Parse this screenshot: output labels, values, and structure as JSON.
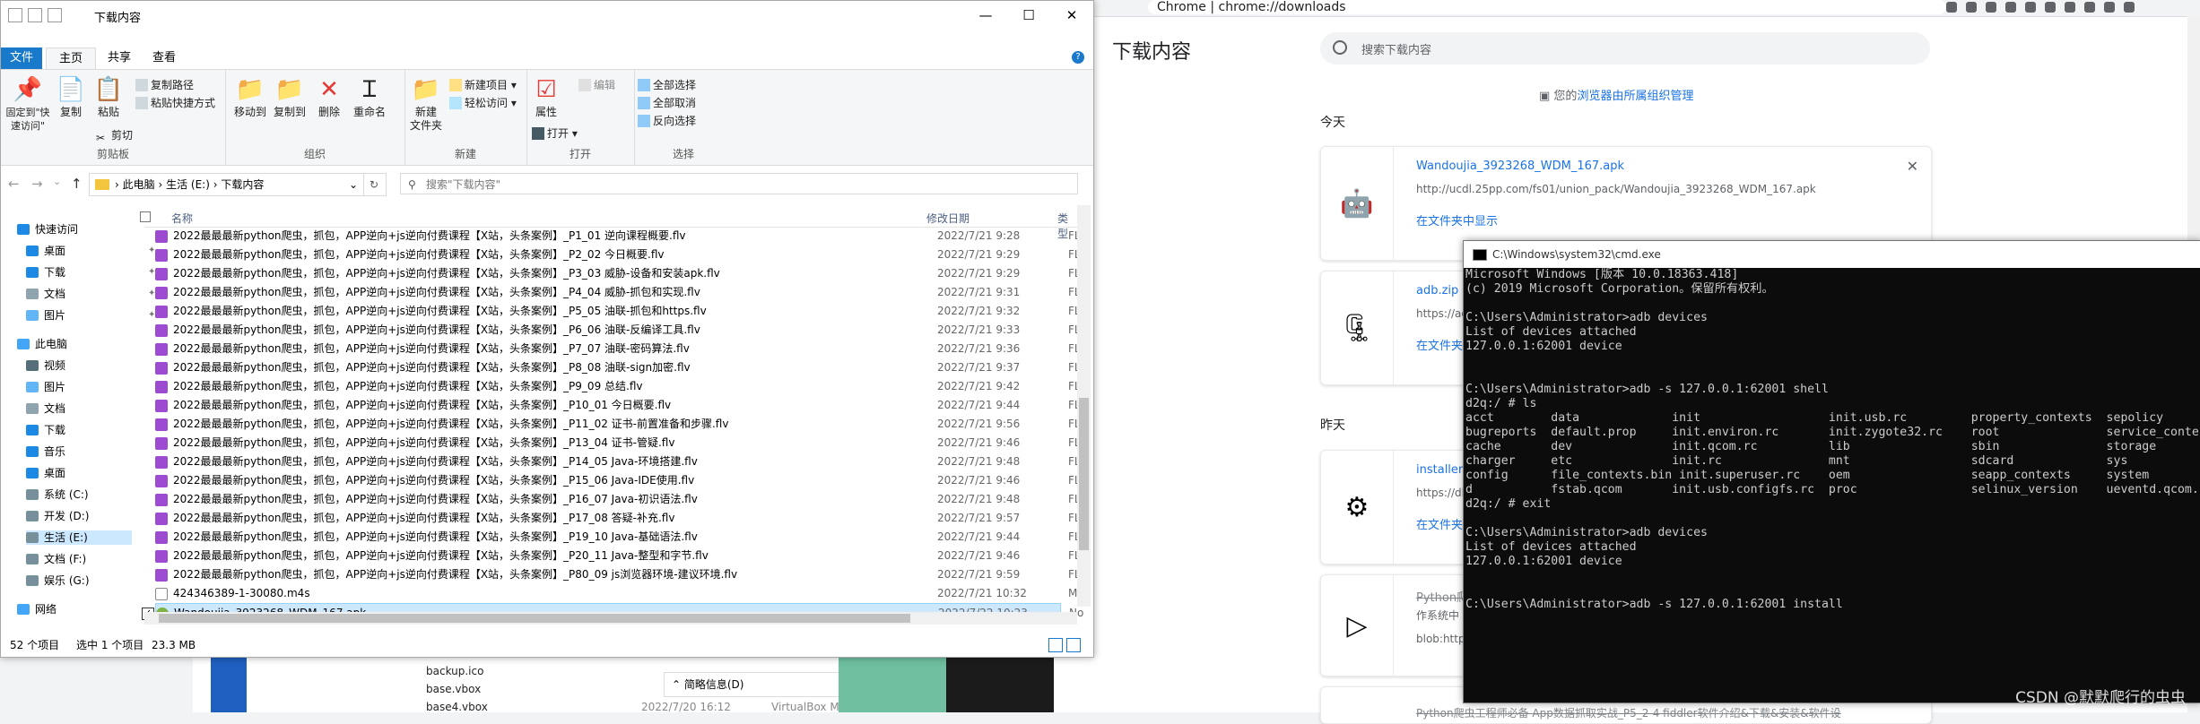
{
  "chrome": {
    "tab_label": "Chrome",
    "url": "chrome://downloads",
    "page_title": "下载内容",
    "search_placeholder": "搜索下载内容",
    "managed_prefix": "您的",
    "managed_link": "浏览器由所属组织管理",
    "today_label": "今天",
    "yesterday_label": "昨天",
    "downloads": [
      {
        "name": "Wandoujia_3923268_WDM_167.apk",
        "url": "http://ucdl.25pp.com/fs01/union_pack/Wandoujia_3923268_WDM_167.apk",
        "action": "在文件夹中显示"
      },
      {
        "name": "adb.zip",
        "url": "https://ad",
        "action": "在文件夹"
      },
      {
        "name": "installer",
        "url": "https://dl",
        "action": "在文件夹"
      },
      {
        "name": "Python爬",
        "url": "作系统中",
        "action": "blob:http"
      }
    ],
    "bottom_partial": "Python爬虫工程师必备 App数据抓取实战_P5_2-4 fiddler软件介绍&下载&安装&软件设"
  },
  "behind_explorer": {
    "rows": [
      "backup.ico",
      "base.vbox",
      "base4.vbox"
    ],
    "details_label": "简略信息(D)",
    "partial_date": "2022/7/20 16:12",
    "partial_type": "VirtualBox M"
  },
  "explorer": {
    "title": "下载内容",
    "window_controls": [
      "—",
      "☐",
      "✕"
    ],
    "tabs": {
      "file": "文件",
      "home": "主页",
      "share": "共享",
      "view": "查看"
    },
    "ribbon": {
      "pin": "固定到\"快速访问\"",
      "copy": "复制",
      "paste": "粘贴",
      "copy_path": "复制路径",
      "paste_shortcut": "粘贴快捷方式",
      "cut": "剪切",
      "clipboard_group": "剪贴板",
      "move_to": "移动到",
      "copy_to": "复制到",
      "delete": "删除",
      "rename": "重命名",
      "organize_group": "组织",
      "new_folder": "新建\n文件夹",
      "new_item": "新建项目",
      "easy_access": "轻松访问",
      "new_group": "新建",
      "properties": "属性",
      "open": "打开",
      "edit": "编辑",
      "open_group": "打开",
      "select_all": "全部选择",
      "select_none": "全部取消",
      "invert": "反向选择",
      "select_group": "选择"
    },
    "breadcrumb": [
      "此电脑",
      "生活 (E:)",
      "下载内容"
    ],
    "search_placeholder": "搜索\"下载内容\"",
    "nav": [
      {
        "label": "快速访问",
        "color": "#1e88e5"
      },
      {
        "label": "桌面",
        "color": "#1e88e5",
        "pinned": true
      },
      {
        "label": "下载",
        "color": "#1e88e5",
        "pinned": true
      },
      {
        "label": "文档",
        "color": "#90a4ae",
        "pinned": true
      },
      {
        "label": "图片",
        "color": "#64b5f6",
        "pinned": true
      },
      {
        "label": "此电脑",
        "color": "#42a5f5"
      },
      {
        "label": "视频",
        "color": "#546e7a"
      },
      {
        "label": "图片",
        "color": "#64b5f6"
      },
      {
        "label": "文档",
        "color": "#90a4ae"
      },
      {
        "label": "下载",
        "color": "#1e88e5"
      },
      {
        "label": "音乐",
        "color": "#1e88e5"
      },
      {
        "label": "桌面",
        "color": "#1e88e5"
      },
      {
        "label": "系统 (C:)",
        "color": "#78909c"
      },
      {
        "label": "开发 (D:)",
        "color": "#78909c"
      },
      {
        "label": "生活 (E:)",
        "color": "#78909c"
      },
      {
        "label": "文档 (F:)",
        "color": "#78909c"
      },
      {
        "label": "娱乐 (G:)",
        "color": "#78909c"
      },
      {
        "label": "网络",
        "color": "#42a5f5"
      }
    ],
    "columns": {
      "name": "名称",
      "date": "修改日期",
      "type": "类型"
    },
    "files": [
      {
        "name": "2022最最最新python爬虫，抓包，APP逆向+js逆向付费课程【X站，头条案例】_P1_01 逆向课程概要.flv",
        "date": "2022/7/21 9:28",
        "type": "FLV"
      },
      {
        "name": "2022最最最新python爬虫，抓包，APP逆向+js逆向付费课程【X站，头条案例】_P2_02 今日概要.flv",
        "date": "2022/7/21 9:29",
        "type": "FLV"
      },
      {
        "name": "2022最最最新python爬虫，抓包，APP逆向+js逆向付费课程【X站，头条案例】_P3_03 威胁-设备和安装apk.flv",
        "date": "2022/7/21 9:29",
        "type": "FLV"
      },
      {
        "name": "2022最最最新python爬虫，抓包，APP逆向+js逆向付费课程【X站，头条案例】_P4_04 威胁-抓包和实现.flv",
        "date": "2022/7/21 9:31",
        "type": "FLV"
      },
      {
        "name": "2022最最最新python爬虫，抓包，APP逆向+js逆向付费课程【X站，头条案例】_P5_05 油联-抓包和https.flv",
        "date": "2022/7/21 9:32",
        "type": "FLV"
      },
      {
        "name": "2022最最最新python爬虫，抓包，APP逆向+js逆向付费课程【X站，头条案例】_P6_06 油联-反编译工具.flv",
        "date": "2022/7/21 9:33",
        "type": "FLV"
      },
      {
        "name": "2022最最最新python爬虫，抓包，APP逆向+js逆向付费课程【X站，头条案例】_P7_07 油联-密码算法.flv",
        "date": "2022/7/21 9:36",
        "type": "FLV"
      },
      {
        "name": "2022最最最新python爬虫，抓包，APP逆向+js逆向付费课程【X站，头条案例】_P8_08 油联-sign加密.flv",
        "date": "2022/7/21 9:37",
        "type": "FLV"
      },
      {
        "name": "2022最最最新python爬虫，抓包，APP逆向+js逆向付费课程【X站，头条案例】_P9_09 总结.flv",
        "date": "2022/7/21 9:42",
        "type": "FLV"
      },
      {
        "name": "2022最最最新python爬虫，抓包，APP逆向+js逆向付费课程【X站，头条案例】_P10_01 今日概要.flv",
        "date": "2022/7/21 9:44",
        "type": "FLV"
      },
      {
        "name": "2022最最最新python爬虫，抓包，APP逆向+js逆向付费课程【X站，头条案例】_P11_02 证书-前置准备和步骤.flv",
        "date": "2022/7/21 9:56",
        "type": "FLV"
      },
      {
        "name": "2022最最最新python爬虫，抓包，APP逆向+js逆向付费课程【X站，头条案例】_P13_04 证书-管疑.flv",
        "date": "2022/7/21 9:46",
        "type": "FLV"
      },
      {
        "name": "2022最最最新python爬虫，抓包，APP逆向+js逆向付费课程【X站，头条案例】_P14_05 Java-环境搭建.flv",
        "date": "2022/7/21 9:48",
        "type": "FLV"
      },
      {
        "name": "2022最最最新python爬虫，抓包，APP逆向+js逆向付费课程【X站，头条案例】_P15_06 Java-IDE使用.flv",
        "date": "2022/7/21 9:46",
        "type": "FLV"
      },
      {
        "name": "2022最最最新python爬虫，抓包，APP逆向+js逆向付费课程【X站，头条案例】_P16_07 Java-初识语法.flv",
        "date": "2022/7/21 9:48",
        "type": "FLV"
      },
      {
        "name": "2022最最最新python爬虫，抓包，APP逆向+js逆向付费课程【X站，头条案例】_P17_08 答疑-补充.flv",
        "date": "2022/7/21 9:57",
        "type": "FLV"
      },
      {
        "name": "2022最最最新python爬虫，抓包，APP逆向+js逆向付费课程【X站，头条案例】_P19_10 Java-基础语法.flv",
        "date": "2022/7/21 9:44",
        "type": "FLV"
      },
      {
        "name": "2022最最最新python爬虫，抓包，APP逆向+js逆向付费课程【X站，头条案例】_P20_11 Java-整型和字节.flv",
        "date": "2022/7/21 9:46",
        "type": "FLV"
      },
      {
        "name": "2022最最最新python爬虫，抓包，APP逆向+js逆向付费课程【X站，头条案例】_P80_09 js浏览器环境-建议环境.flv",
        "date": "2022/7/21 9:59",
        "type": "FLV"
      },
      {
        "name": "424346389-1-30080.m4s",
        "date": "2022/7/21 10:32",
        "type": "M4"
      },
      {
        "name": "Wandoujia_3923268_WDM_167.apk",
        "date": "2022/7/22 10:23",
        "type": "No"
      }
    ],
    "status": {
      "count": "52 个项目",
      "selected": "选中 1 个项目",
      "size": "23.3 MB"
    }
  },
  "cmd": {
    "title": "C:\\Windows\\system32\\cmd.exe",
    "lines": [
      "Microsoft Windows [版本 10.0.18363.418]",
      "(c) 2019 Microsoft Corporation。保留所有权利。",
      "",
      "C:\\Users\\Administrator>adb devices",
      "List of devices attached",
      "127.0.0.1:62001 device",
      "",
      "",
      "C:\\Users\\Administrator>adb -s 127.0.0.1:62001 shell",
      "d2q:/ # ls",
      "acct        data             init                  init.usb.rc         property_contexts  sepolicy",
      "bugreports  default.prop     init.environ.rc       init.zygote32.rc    root               service_conte",
      "cache       dev              init.qcom.rc          lib                 sbin               storage",
      "charger     etc              init.rc               mnt                 sdcard             sys",
      "config      file_contexts.bin init.superuser.rc    oem                 seapp_contexts     system",
      "d           fstab.qcom       init.usb.configfs.rc  proc                selinux_version    ueventd.qcom.",
      "d2q:/ # exit",
      "",
      "C:\\Users\\Administrator>adb devices",
      "List of devices attached",
      "127.0.0.1:62001 device",
      "",
      "",
      "C:\\Users\\Administrator>adb -s 127.0.0.1:62001 install"
    ]
  },
  "watermark": "CSDN @默默爬行的虫虫"
}
